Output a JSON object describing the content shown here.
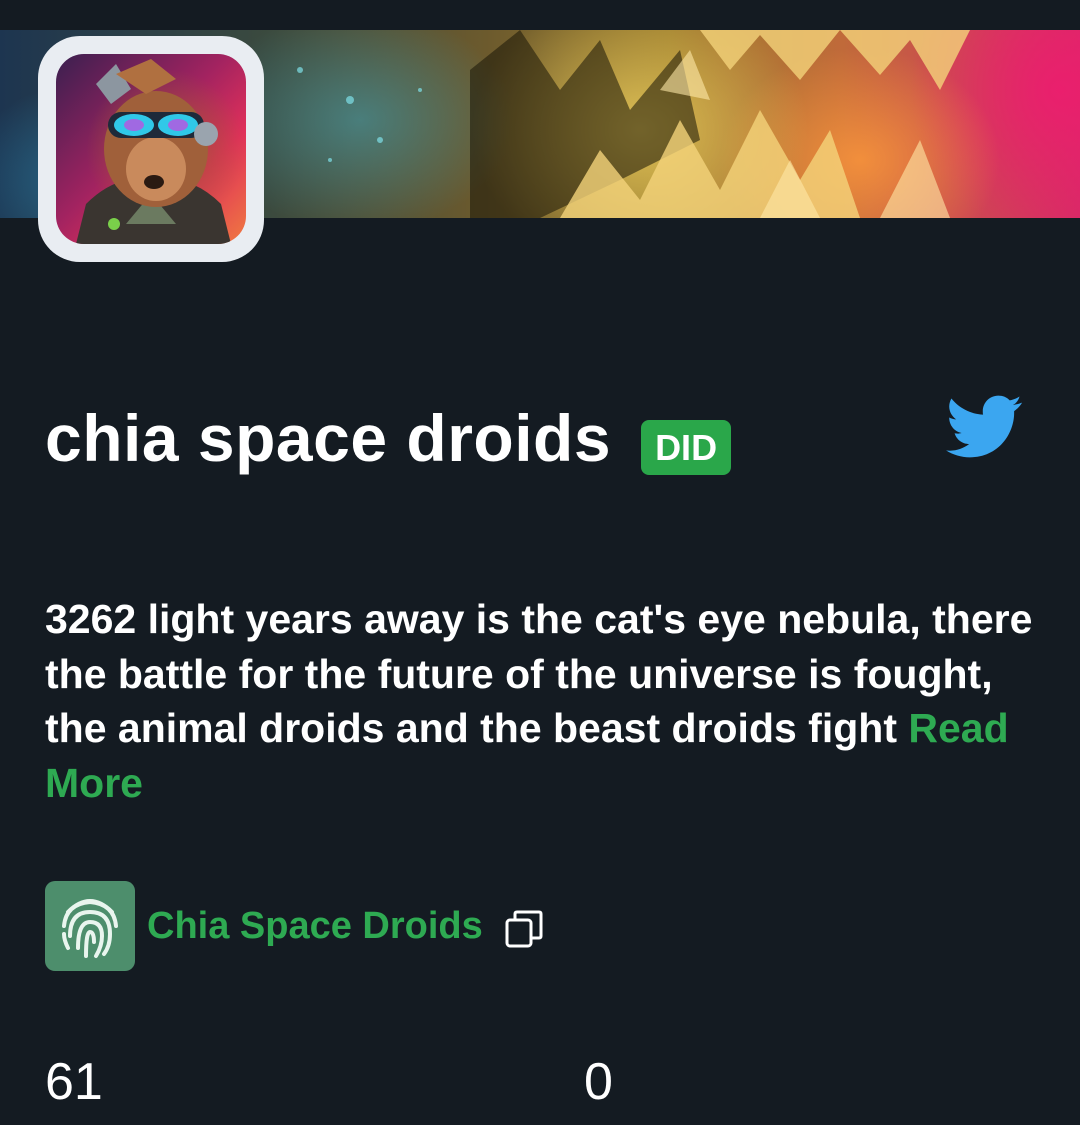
{
  "collection": {
    "name": "chia space droids",
    "badge": "DID",
    "description": "3262 light years away is the cat's eye nebula, there the battle for the future of the universe is fought, the animal droids and the beast droids fight",
    "read_more_label": "Read More"
  },
  "creator": {
    "name": "Chia Space Droids",
    "icon": "fingerprint-icon"
  },
  "social": {
    "icon": "twitter-icon"
  },
  "stats": {
    "first": "61",
    "second": "0"
  },
  "colors": {
    "background": "#141b22",
    "accent_green": "#2eaa52",
    "badge_green": "#2aa74a",
    "twitter_blue": "#3ba6f0"
  }
}
